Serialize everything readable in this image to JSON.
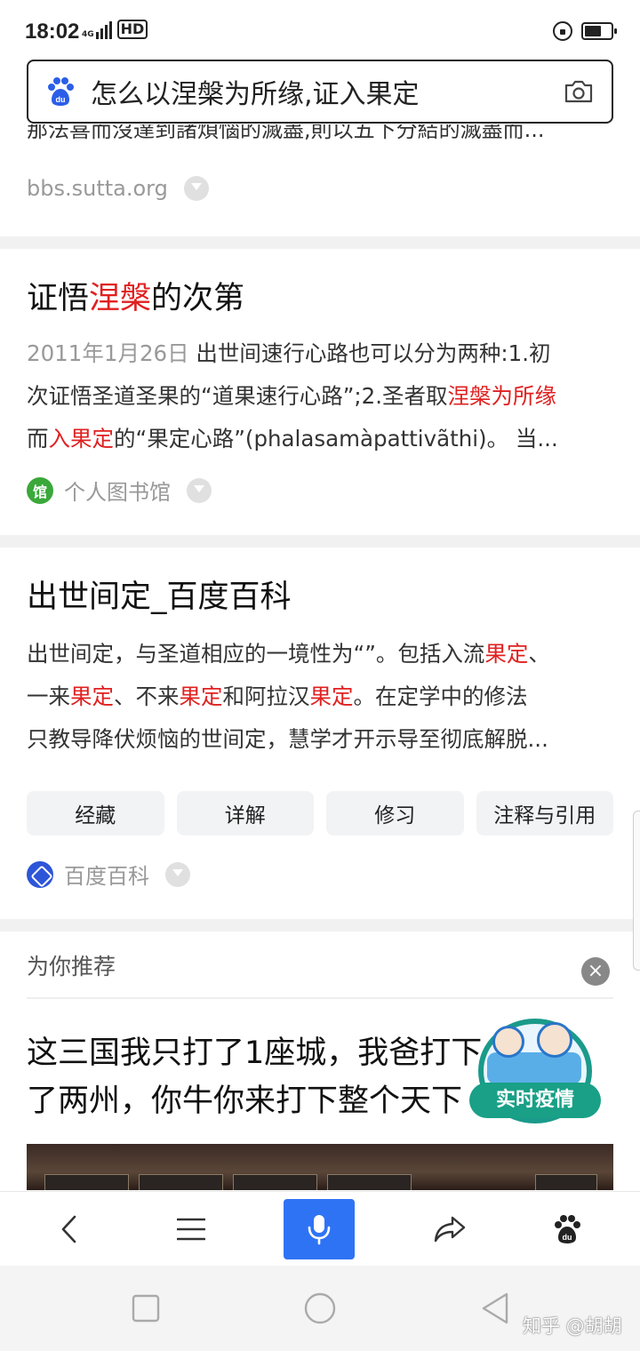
{
  "status_bar": {
    "time": "18:02",
    "network": "4G",
    "hd": "HD"
  },
  "search": {
    "query": "怎么以涅槃为所缘,证入果定"
  },
  "partial_result": {
    "snippet": "那法喜而沒達到諸煩惱的滅盡,則以五下分結的滅盡而...",
    "source": "bbs.sutta.org"
  },
  "result1": {
    "title_pre": "证悟",
    "title_red": "涅槃",
    "title_post": "的次第",
    "date": "2011年1月26日",
    "line1_text": " 出世间速行心路也可以分为两种:1.初",
    "line2_pre": "次证悟圣道圣果的“道果速行心路”;2.圣者取",
    "line2_red": "涅槃为所缘",
    "line3_pre": "而",
    "line3_red": "入果定",
    "line3_post": "的“果定心路”(phalasamàpattivãthi)。 当...",
    "source_icon_text": "馆",
    "source": "个人图书馆"
  },
  "result2": {
    "title": "出世间定_百度百科",
    "line1_pre": "出世间定，与圣道相应的一境性为“”。包括入流",
    "line1_red": "果定",
    "line1_post": "、",
    "line2_a": "一来",
    "line2_b": "果定",
    "line2_c": "、不来",
    "line2_d": "果定",
    "line2_e": "和阿拉汉",
    "line2_f": "果定",
    "line2_g": "。在定学中的修法",
    "line3": "只教导降伏烦恼的世间定，慧学才开示导至彻底解脱...",
    "chips": [
      "经藏",
      "详解",
      "修习",
      "注释与引用"
    ],
    "source": "百度百科"
  },
  "recommend": {
    "header": "为你推荐",
    "close": "×",
    "title": "这三国我只打了1座城，我爸打下了两州，你牛你来打下整个天下",
    "badge": "实时疫情"
  },
  "watermark": "知乎 @胡胡",
  "colors": {
    "accent_blue": "#2f73f5",
    "highlight_red": "#e02020",
    "epidemic_green": "#19a087"
  },
  "icons": {
    "toolbar": [
      "back-icon",
      "menu-icon",
      "mic-icon",
      "share-icon",
      "baidu-icon"
    ],
    "navbar": [
      "recents-icon",
      "home-icon",
      "back-triangle-icon"
    ]
  }
}
